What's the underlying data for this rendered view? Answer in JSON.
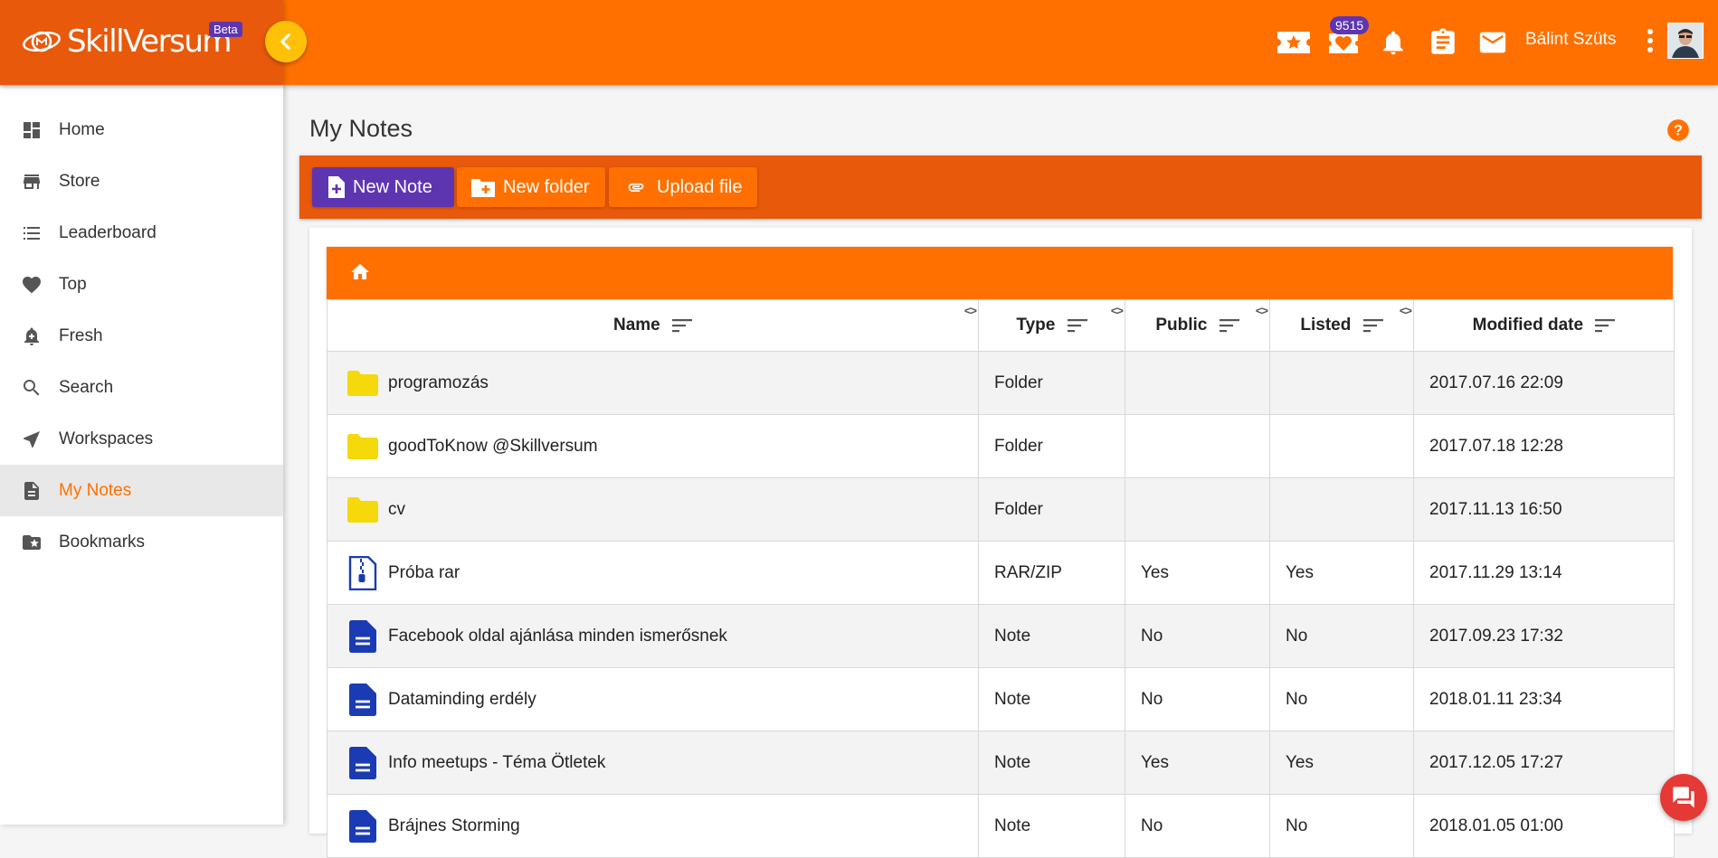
{
  "brand": {
    "logo_text": "SkillVersum",
    "beta_label": "Beta"
  },
  "topbar": {
    "points_badge": "9515",
    "user_name": "Bálint Szüts",
    "icons": [
      "ticket-star-icon",
      "heart-badge-icon",
      "bell-icon",
      "clipboard-icon",
      "mail-icon",
      "more-vert-icon"
    ]
  },
  "sidebar": {
    "items": [
      {
        "label": "Home",
        "icon": "dashboard-icon"
      },
      {
        "label": "Store",
        "icon": "store-icon"
      },
      {
        "label": "Leaderboard",
        "icon": "list-icon"
      },
      {
        "label": "Top",
        "icon": "heart-icon"
      },
      {
        "label": "Fresh",
        "icon": "bell-plus-icon"
      },
      {
        "label": "Search",
        "icon": "search-icon"
      },
      {
        "label": "Workspaces",
        "icon": "navigation-icon"
      },
      {
        "label": "My Notes",
        "icon": "document-icon",
        "active": true
      },
      {
        "label": "Bookmarks",
        "icon": "bookmark-folder-icon"
      }
    ]
  },
  "page": {
    "title": "My Notes"
  },
  "toolbar": {
    "new_note": "New Note",
    "new_folder": "New folder",
    "upload_file": "Upload file"
  },
  "table": {
    "headers": {
      "name": "Name",
      "type": "Type",
      "public": "Public",
      "listed": "Listed",
      "modified": "Modified date"
    },
    "rows": [
      {
        "name": "programozás",
        "type": "Folder",
        "public": "",
        "listed": "",
        "modified": "2017.07.16 22:09",
        "kind": "folder"
      },
      {
        "name": "goodToKnow @Skillversum",
        "type": "Folder",
        "public": "",
        "listed": "",
        "modified": "2017.07.18 12:28",
        "kind": "folder"
      },
      {
        "name": "cv",
        "type": "Folder",
        "public": "",
        "listed": "",
        "modified": "2017.11.13 16:50",
        "kind": "folder"
      },
      {
        "name": "Próba rar",
        "type": "RAR/ZIP",
        "public": "Yes",
        "listed": "Yes",
        "modified": "2017.11.29 13:14",
        "kind": "zip"
      },
      {
        "name": "Facebook oldal ajánlása minden ismerősnek",
        "type": "Note",
        "public": "No",
        "listed": "No",
        "modified": "2017.09.23 17:32",
        "kind": "note"
      },
      {
        "name": "Dataminding erdély",
        "type": "Note",
        "public": "No",
        "listed": "No",
        "modified": "2018.01.11 23:34",
        "kind": "note"
      },
      {
        "name": "Info meetups - Téma Ötletek",
        "type": "Note",
        "public": "Yes",
        "listed": "Yes",
        "modified": "2017.12.05 17:27",
        "kind": "note"
      },
      {
        "name": "Brájnes Storming",
        "type": "Note",
        "public": "No",
        "listed": "No",
        "modified": "2018.01.05 01:00",
        "kind": "note"
      }
    ]
  },
  "colors": {
    "accent": "#ff7000",
    "accent_dark": "#e8590c",
    "purple": "#5e35b1",
    "folder": "#f5d90a",
    "note_blue": "#1a3bb3"
  }
}
